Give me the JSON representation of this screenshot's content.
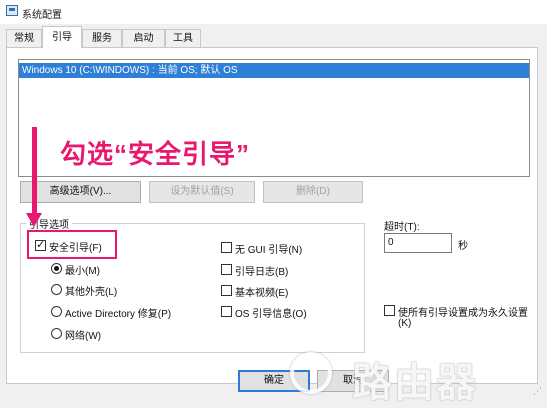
{
  "window": {
    "title": "系统配置"
  },
  "tabs": [
    {
      "label": "常规"
    },
    {
      "label": "引导"
    },
    {
      "label": "服务"
    },
    {
      "label": "启动"
    },
    {
      "label": "工具"
    }
  ],
  "os_list": {
    "items": [
      "Windows 10 (C:\\WINDOWS) : 当前 OS; 默认 OS"
    ]
  },
  "buttons": {
    "advanced": "高级选项(V)...",
    "set_default": "设为默认值(S)",
    "delete": "删除(D)",
    "ok": "确定",
    "cancel": "取消"
  },
  "boot_options": {
    "group_title": "引导选项",
    "safe_boot": {
      "label": "安全引导(F)",
      "checked": true
    },
    "radios": [
      {
        "label": "最小(M)",
        "checked": true
      },
      {
        "label": "其他外壳(L)",
        "checked": false
      },
      {
        "label": "Active Directory 修复(P)",
        "checked": false
      },
      {
        "label": "网络(W)",
        "checked": false
      }
    ],
    "checkboxes": [
      {
        "label": "无 GUI 引导(N)",
        "checked": false
      },
      {
        "label": "引导日志(B)",
        "checked": false
      },
      {
        "label": "基本视频(E)",
        "checked": false
      },
      {
        "label": "OS 引导信息(O)",
        "checked": false
      }
    ]
  },
  "timeout": {
    "label": "超时(T):",
    "value": "0",
    "unit": "秒"
  },
  "permanent": {
    "label_line1": "使所有引导设置成为永久设置",
    "label_line2": "(K)",
    "checked": false
  },
  "annotation": {
    "text": "勾选“安全引导”",
    "color": "#e8186f"
  },
  "watermark": {
    "text": "路由器"
  },
  "colors": {
    "selection": "#2f7fd6",
    "accent": "#e8186f"
  }
}
